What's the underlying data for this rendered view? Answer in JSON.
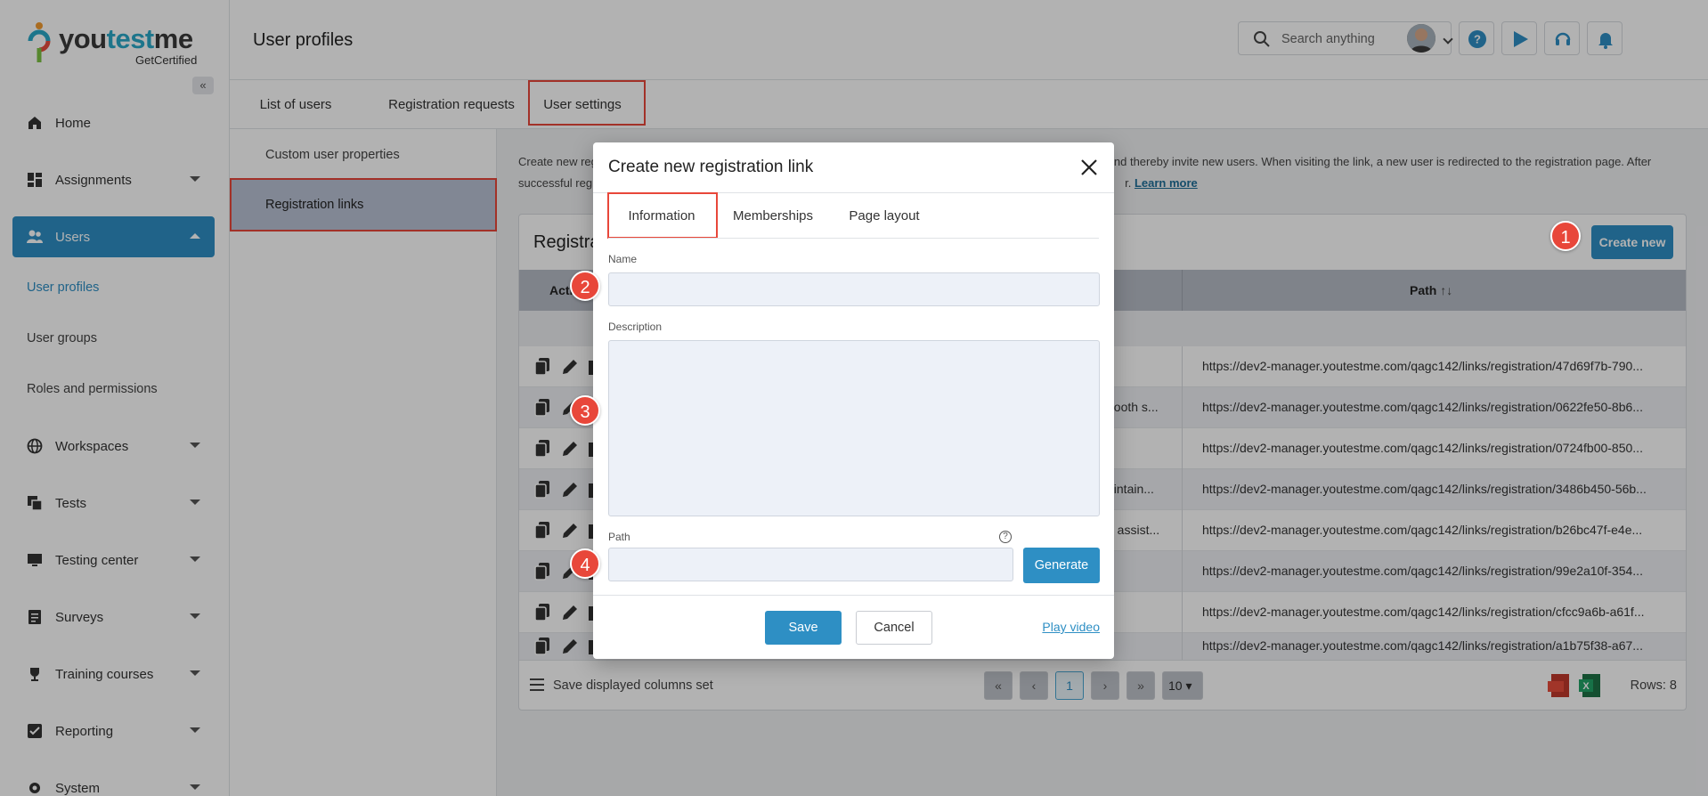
{
  "brand": {
    "name_a": "you",
    "name_b": "test",
    "name_c": "me",
    "sub": "GetCertified"
  },
  "sidebar": {
    "collapse_label": "«",
    "items": [
      {
        "label": "Home"
      },
      {
        "label": "Assignments"
      },
      {
        "label": "Users"
      },
      {
        "label": "Workspaces"
      },
      {
        "label": "Tests"
      },
      {
        "label": "Testing center"
      },
      {
        "label": "Surveys"
      },
      {
        "label": "Training courses"
      },
      {
        "label": "Reporting"
      },
      {
        "label": "System"
      }
    ],
    "sub_items": [
      {
        "label": "User profiles"
      },
      {
        "label": "User groups"
      },
      {
        "label": "Roles and permissions"
      }
    ]
  },
  "header": {
    "title": "User profiles",
    "search_placeholder": "Search anything"
  },
  "tabs": [
    {
      "label": "List of users"
    },
    {
      "label": "Registration requests"
    },
    {
      "label": "User settings"
    }
  ],
  "subpanel": [
    {
      "label": "Custom user properties"
    },
    {
      "label": "Registration links"
    }
  ],
  "main": {
    "desc_line1_a": "Create new reg",
    "desc_line1_b": "nd thereby invite new users. When visiting the link, a new user is redirected to the registration page. After",
    "desc_line2_a": "successful reg",
    "desc_line2_b": "r.",
    "learn_more": "Learn more",
    "card_title": "Registra",
    "create_new": "Create new",
    "col_actions": "Acti",
    "col_path": "Path",
    "sort_icon": "↑↓",
    "rows": [
      {
        "name": "",
        "path": "https://dev2-manager.youtestme.com/qagc142/links/registration/47d69f7b-790..."
      },
      {
        "name": "nooth s...",
        "path": "https://dev2-manager.youtestme.com/qagc142/links/registration/0622fe50-8b6..."
      },
      {
        "name": "",
        "path": "https://dev2-manager.youtestme.com/qagc142/links/registration/0724fb00-850..."
      },
      {
        "name": "aintain...",
        "path": "https://dev2-manager.youtestme.com/qagc142/links/registration/3486b450-56b..."
      },
      {
        "name": "d assist...",
        "path": "https://dev2-manager.youtestme.com/qagc142/links/registration/b26bc47f-e4e..."
      },
      {
        "name": "",
        "path": "https://dev2-manager.youtestme.com/qagc142/links/registration/99e2a10f-354..."
      },
      {
        "name": "",
        "path": "https://dev2-manager.youtestme.com/qagc142/links/registration/cfcc9a6b-a61f..."
      },
      {
        "name": "",
        "path": "https://dev2-manager.youtestme.com/qagc142/links/registration/a1b75f38-a67..."
      }
    ],
    "save_columns": "Save displayed columns set",
    "page_current": "1",
    "page_size": "10",
    "rows_count": "Rows: 8"
  },
  "modal": {
    "title": "Create new registration link",
    "tabs": [
      {
        "label": "Information"
      },
      {
        "label": "Memberships"
      },
      {
        "label": "Page layout"
      }
    ],
    "name_label": "Name",
    "name_value": "",
    "description_label": "Description",
    "description_value": "",
    "path_label": "Path",
    "path_value": "",
    "generate": "Generate",
    "save": "Save",
    "cancel": "Cancel",
    "play_video": "Play video"
  },
  "badges": [
    "1",
    "2",
    "3",
    "4"
  ],
  "colors": {
    "accent": "#2e8fc4",
    "highlight": "#e8473a"
  }
}
